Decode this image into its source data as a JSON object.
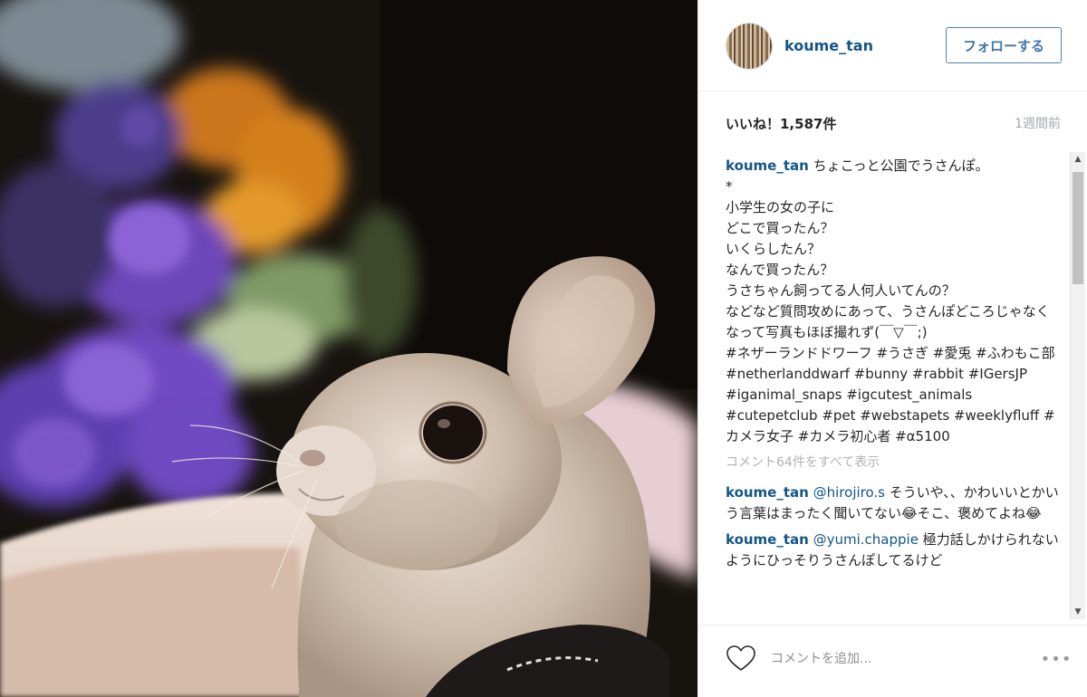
{
  "post": {
    "username": "koume_tan",
    "follow_label": "フォローする",
    "likes": "いいね！1,587件",
    "time": "1週間前",
    "caption_text": "ちょこっと公園でうさんぽ。\n*\n小学生の女の子に\nどこで買ったん？\nいくらしたん？\nなんで買ったん？\nうさちゃん飼ってる人何人いてんの？\nなどなど質問攻めにあって、うさんぽどころじゃなくなって写真もほぼ撮れず(￣▽￣;)\n#ネザーランドドワーフ #うさぎ #愛兎 #ふわもこ部 #netherlanddwarf #bunny #rabbit #IGersJP #iganimal_snaps #igcutest_animals #cutepetclub #pet #webstapets #weeklyfluff #カメラ女子 #カメラ初心者 #α5100",
    "view_all": "コメント64件をすべて表示",
    "replies": [
      {
        "user": "koume_tan",
        "mention": "@hirojiro.s",
        "text": " そういや、、かわいいとかいう言葉はまったく聞いてない😂そこ、褒めてよね😂"
      },
      {
        "user": "koume_tan",
        "mention": "@yumi.chappie",
        "text": " 極力話しかけられないようにひっそりうさんぽしてるけど"
      }
    ],
    "add_comment_placeholder": "コメントを追加...",
    "more_label": "•••"
  },
  "icons": {
    "heart": "heart-outline-icon",
    "more": "more-options-icon",
    "scroll_up": "scroll-up-arrow-icon",
    "scroll_down": "scroll-down-arrow-icon"
  },
  "colors": {
    "link": "#125688",
    "follow_border": "#4b83b5",
    "muted": "#a5a7aa"
  }
}
